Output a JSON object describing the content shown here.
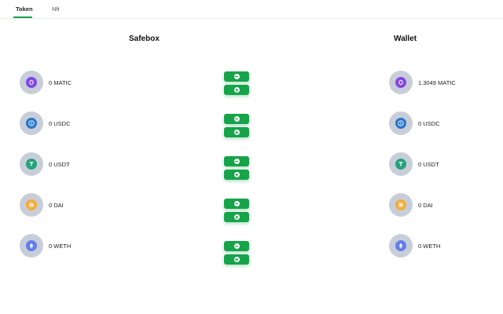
{
  "tabs": {
    "token": "Token",
    "nft": "Nft"
  },
  "columns": {
    "safebox": "Safebox",
    "wallet": "Wallet"
  },
  "colors": {
    "accent": "#16a34a",
    "icon_bg": "#c8ced9"
  },
  "tokens": [
    {
      "symbol": "MATIC",
      "icon": "polygon-icon",
      "color": "#8247e5",
      "safebox": "0 MATIC",
      "wallet": "1.3049 MATIC"
    },
    {
      "symbol": "USDC",
      "icon": "usdc-icon",
      "color": "#2775ca",
      "safebox": "0 USDC",
      "wallet": "0 USDC"
    },
    {
      "symbol": "USDT",
      "icon": "tether-icon",
      "color": "#26a17b",
      "safebox": "0 USDT",
      "wallet": "0 USDT"
    },
    {
      "symbol": "DAI",
      "icon": "dai-icon",
      "color": "#f5ac37",
      "safebox": "0 DAI",
      "wallet": "0 DAI"
    },
    {
      "symbol": "WETH",
      "icon": "ethereum-icon",
      "color": "#627eea",
      "safebox": "0 WETH",
      "wallet": "0 WETH"
    }
  ]
}
